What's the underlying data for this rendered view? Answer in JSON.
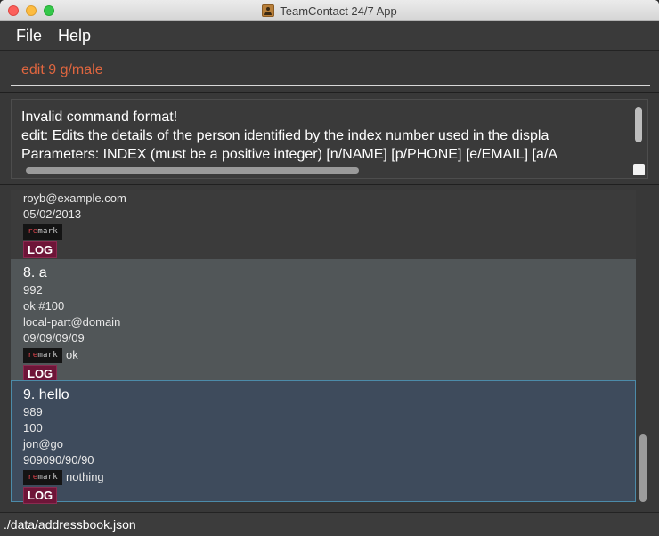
{
  "window": {
    "title": "TeamContact 24/7 App"
  },
  "menu": {
    "items": [
      "File",
      "Help"
    ]
  },
  "command": {
    "value": "edit 9 g/male"
  },
  "result": {
    "lines": [
      "Invalid command format!",
      "edit: Edits the details of the person identified by the index number used in the displa",
      "Parameters: INDEX (must be a positive integer) [n/NAME] [p/PHONE] [e/EMAIL] [a/A"
    ]
  },
  "persons": [
    {
      "email": "royb@example.com",
      "date": "05/02/2013",
      "remark_icon": "remark",
      "remark_text": "",
      "tag": "LOG"
    },
    {
      "index_name": "8.  a",
      "phone": "992",
      "address": "ok #100",
      "email": "local-part@domain",
      "date": "09/09/09/09",
      "remark_icon": "remark",
      "remark_text": "ok",
      "tag": "LOG"
    },
    {
      "index_name": "9.  hello",
      "phone": "989",
      "address": "100",
      "email": "jon@go",
      "date": "909090/90/90",
      "remark_icon": "remark",
      "remark_text": "nothing",
      "tag": "LOG"
    }
  ],
  "status": {
    "file_path": "./data/addressbook.json"
  },
  "colors": {
    "command_text": "#e0663f",
    "tag_background": "#6e1538",
    "selected_card": "#3e4b5c"
  }
}
